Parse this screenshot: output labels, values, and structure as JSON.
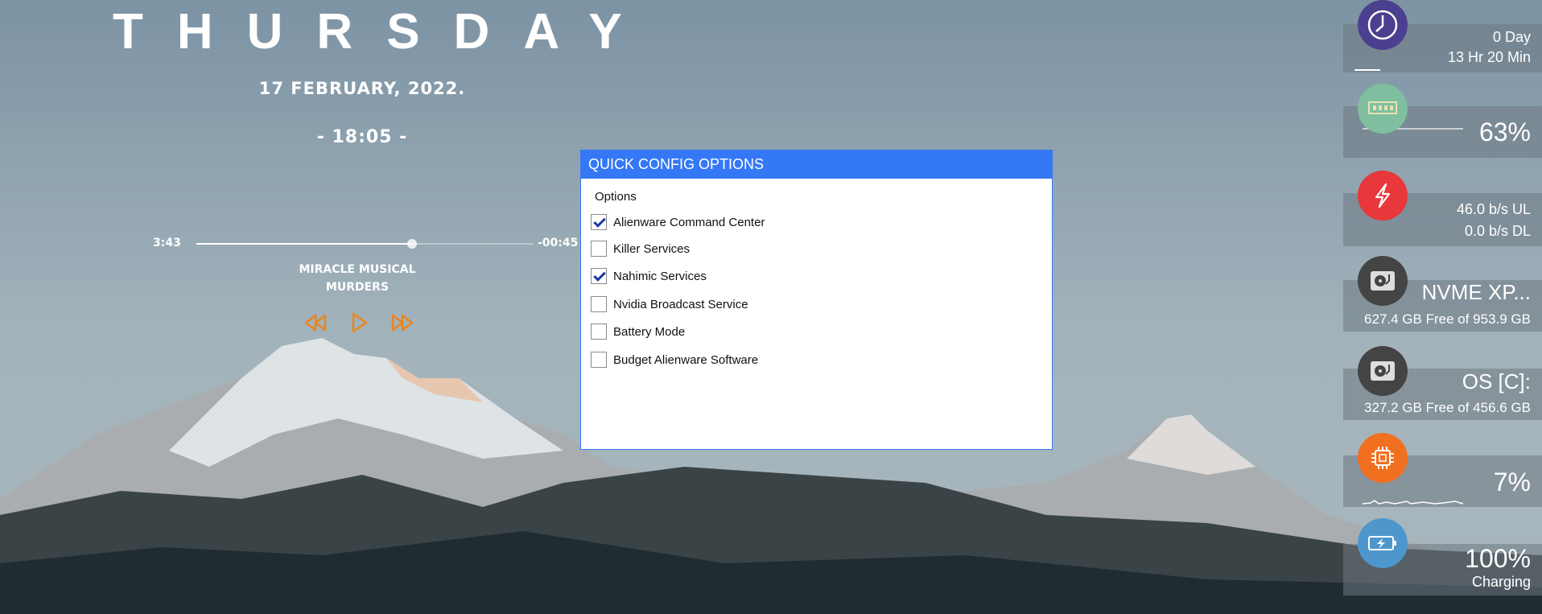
{
  "clock": {
    "day": "THURSDAY",
    "date": "17  FEBRUARY,  2022.",
    "time": "- 18:05 -"
  },
  "music": {
    "elapsed": "3:43",
    "remaining": "-00:45",
    "progress_fraction": 0.64,
    "artist": "MIRACLE MUSICAL",
    "song": "MURDERS",
    "controls": [
      "rewind-icon",
      "play-icon",
      "fast-forward-icon"
    ],
    "accent_color": "#e8861c"
  },
  "dialog": {
    "title": "QUICK CONFIG OPTIONS",
    "group_label": "Options",
    "options": [
      {
        "label": "Alienware Command Center",
        "checked": true
      },
      {
        "label": "Killer Services",
        "checked": false
      },
      {
        "label": "Nahimic Services",
        "checked": true
      },
      {
        "label": "Nvidia Broadcast Service",
        "checked": false
      },
      {
        "label": "Battery Mode",
        "checked": false
      },
      {
        "label": "Budget Alienware Software",
        "checked": false
      }
    ],
    "accent_color": "#3478f6"
  },
  "sidebar": {
    "uptime": {
      "icon": "clock-icon",
      "line1": "0 Day",
      "line2": "13 Hr   20 Min",
      "color": "#4b3f8f"
    },
    "ram": {
      "icon": "memory-icon",
      "value": "63%",
      "fraction": 0.63,
      "color": "#7fbfa0"
    },
    "network": {
      "icon": "network-icon",
      "upload": "46.0 b/s  UL",
      "download": "0.0 b/s  DL",
      "color": "#e8383b"
    },
    "drive1": {
      "icon": "hard-drive-icon",
      "name": "NVME XP...",
      "free": "627.4 GB Free of 953.9 GB",
      "color": "#444444"
    },
    "drive2": {
      "icon": "hard-drive-icon",
      "name": "OS [C]:",
      "free": "327.2 GB Free of 456.6 GB",
      "color": "#444444"
    },
    "cpu": {
      "icon": "cpu-icon",
      "value": "7%",
      "color": "#f07020"
    },
    "battery": {
      "icon": "battery-icon",
      "value": "100%",
      "status": "Charging",
      "color": "#4d97cc"
    }
  }
}
